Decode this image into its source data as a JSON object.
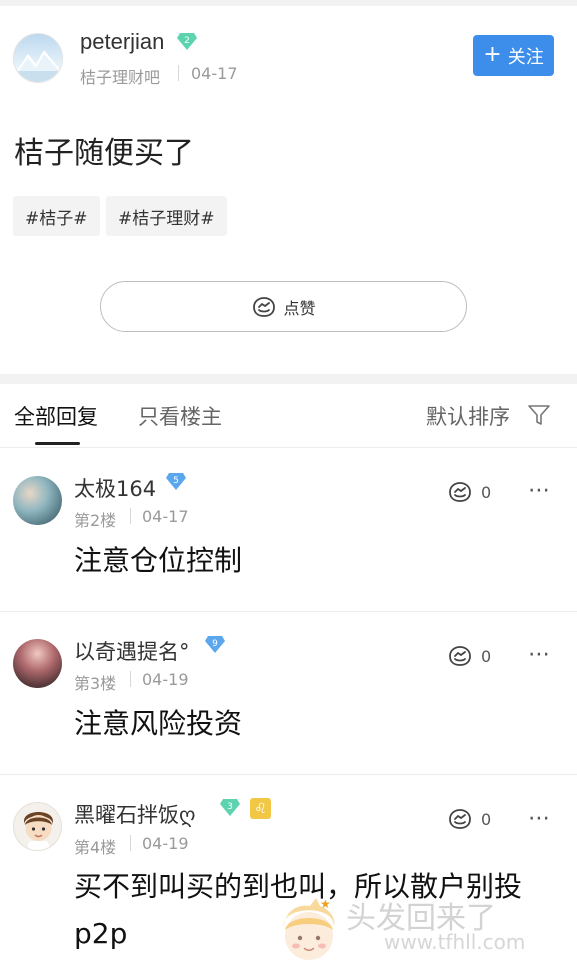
{
  "post": {
    "author": "peterjian",
    "author_level": "2",
    "forum": "桔子理财吧",
    "date": "04-17",
    "follow_label": "关注",
    "follow_icon": "+",
    "content": "桔子随便买了",
    "tags": [
      "#桔子#",
      "#桔子理财#"
    ],
    "like_label": "点赞"
  },
  "tabs": {
    "all_replies": "全部回复",
    "only_op": "只看楼主",
    "sort": "默认排序"
  },
  "replies": [
    {
      "name": "太极164",
      "level": "5",
      "floor": "第2楼",
      "date": "04-17",
      "likes": "0",
      "content": "注意仓位控制"
    },
    {
      "name": "以奇遇提名°",
      "level": "9",
      "floor": "第3楼",
      "date": "04-19",
      "likes": "0",
      "content": "注意风险投资"
    },
    {
      "name": "黑曜石拌饭ღ",
      "level": "3",
      "extra_badge": "♌",
      "floor": "第4楼",
      "date": "04-19",
      "likes": "0",
      "content_line1": "买不到叫买的到也叫，所以散户别投",
      "content_line2": "p2p"
    }
  ],
  "watermark": {
    "text": "头发回来了",
    "url": "www.tfhll.com"
  },
  "colors": {
    "accent_blue": "#3d8eea",
    "level_badge_green": "#5dd3b0",
    "level_badge_blue": "#5aa7ee",
    "meta_gray": "#9a9a9a"
  },
  "icons": {
    "like": "thumbs-up-icon",
    "more": "more-dots-icon",
    "filter": "filter-icon",
    "level": "diamond-level-icon"
  }
}
